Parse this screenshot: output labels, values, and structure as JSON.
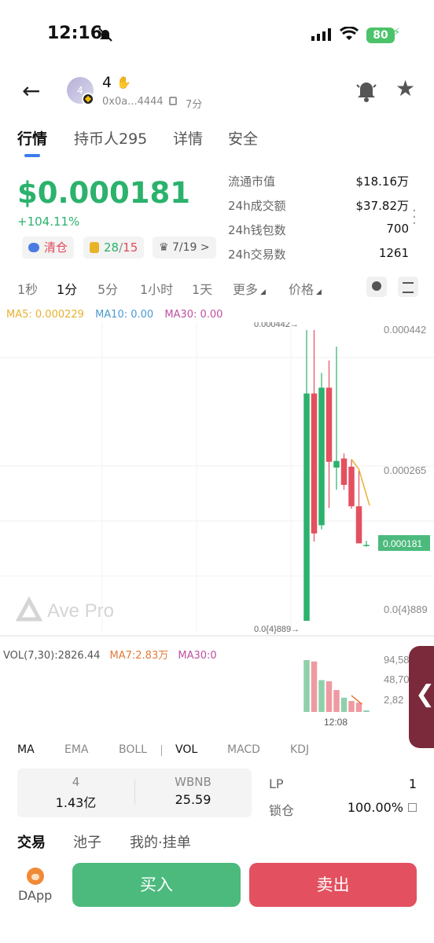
{
  "status_bar": {
    "time": "12:16",
    "battery": "80"
  },
  "header": {
    "token_name": "4",
    "avatar_text": "4",
    "address": "0x0a...4444",
    "age": "7分"
  },
  "tabs": [
    "行情",
    "持币人295",
    "详情",
    "安全"
  ],
  "price": {
    "value": "$0.000181",
    "change": "+104.11%"
  },
  "pills": {
    "clear": "清仓",
    "wallet_green": "28",
    "wallet_sep": "/",
    "wallet_red": "15",
    "crown": "7/19 >"
  },
  "stats": [
    {
      "label": "流通市值",
      "value": "$18.16万"
    },
    {
      "label": "24h成交额",
      "value": "$37.82万"
    },
    {
      "label": "24h钱包数",
      "value": "700"
    },
    {
      "label": "24h交易数",
      "value": "1261"
    }
  ],
  "timeframes": [
    "1秒",
    "1分",
    "5分",
    "1小时",
    "1天",
    "更多",
    "价格"
  ],
  "ma_legend": {
    "ma5": "MA5: 0.000229",
    "ma10": "MA10: 0.00",
    "ma30": "MA30: 0.00"
  },
  "watermark": "Ave Pro",
  "vol_legend": {
    "vol": "VOL(7,30):2826.44",
    "ma7": "MA7:2.83万",
    "ma30": "MA30:0"
  },
  "indicators": [
    "MA",
    "EMA",
    "BOLL",
    "VOL",
    "MACD",
    "KDJ"
  ],
  "pool": [
    {
      "name": "4",
      "value": "1.43亿"
    },
    {
      "name": "WBNB",
      "value": "25.59"
    }
  ],
  "lp": [
    {
      "label": "LP",
      "value": "1"
    },
    {
      "label": "锁仓",
      "value": "100.00%"
    }
  ],
  "bottom_tabs": [
    "交易",
    "池子",
    "我的·挂单"
  ],
  "dapp_label": "DApp",
  "buy_label": "买入",
  "sell_label": "卖出",
  "colors": {
    "up": "#2bb26c",
    "down": "#e3505f",
    "ma5": "#e8b130",
    "ma10": "#4a9bd1",
    "ma30": "#c04fa0"
  },
  "chart_data": {
    "type": "candlestick",
    "axis_labels": [
      "0.000442",
      "0.000265",
      "0.0{4}889"
    ],
    "max_marker": "0.000442→",
    "min_marker": "0.0{4}889→",
    "current_price_tag": "0.000181",
    "time_label": "12:08",
    "vol_axis_labels": [
      "94,58",
      "48,70",
      "2,82"
    ],
    "candles": [
      {
        "open": 8.89e-05,
        "close": 0.000365,
        "high": 0.000442,
        "low": 8.89e-05
      },
      {
        "open": 0.000365,
        "close": 0.000195,
        "high": 0.000442,
        "low": 0.000185
      },
      {
        "open": 0.000205,
        "close": 0.000372,
        "high": 0.00039,
        "low": 0.0002
      },
      {
        "open": 0.000372,
        "close": 0.000282,
        "high": 0.000405,
        "low": 0.000226
      },
      {
        "open": 0.000275,
        "close": 0.000283,
        "high": 0.000422,
        "low": 0.000248
      },
      {
        "open": 0.000286,
        "close": 0.000254,
        "high": 0.000292,
        "low": 0.000248
      },
      {
        "open": 0.000276,
        "close": 0.000228,
        "high": 0.000285,
        "low": 0.000225
      },
      {
        "open": 0.000228,
        "close": 0.000183,
        "high": 0.000271,
        "low": 0.000183
      },
      {
        "open": 0.000181,
        "close": 0.000181,
        "high": 0.000186,
        "low": 0.000179
      }
    ],
    "ma5_line": [
      0.000285,
      0.000273,
      0.000229
    ],
    "volumes": [
      {
        "value": 94580,
        "up": true
      },
      {
        "value": 92000,
        "up": false
      },
      {
        "value": 58000,
        "up": true
      },
      {
        "value": 56000,
        "up": false
      },
      {
        "value": 40000,
        "up": false
      },
      {
        "value": 26000,
        "up": true
      },
      {
        "value": 20000,
        "up": false
      },
      {
        "value": 17000,
        "up": false
      },
      {
        "value": 2826,
        "up": true
      }
    ],
    "vol_ma7_line": [
      30000,
      14000
    ],
    "ylim": [
      8.89e-05,
      0.000442
    ]
  }
}
